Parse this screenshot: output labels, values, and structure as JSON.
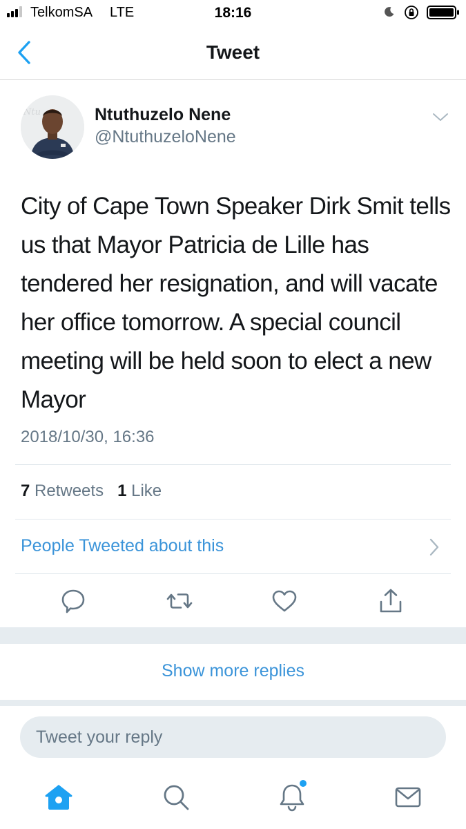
{
  "status_bar": {
    "carrier": "TelkomSA",
    "network": "LTE",
    "time": "18:16",
    "signal_bars_filled": 3,
    "signal_bars_total": 4
  },
  "nav": {
    "title": "Tweet",
    "back_icon": "chevron-left-icon"
  },
  "tweet": {
    "author_name": "Ntuthuzelo Nene",
    "author_handle": "@NtuthuzeloNene",
    "text": "City of Cape Town Speaker Dirk Smit tells us that Mayor Patricia de Lille has tendered her resignation, and will vacate her office tomorrow. A special council meeting will be held soon to elect a new Mayor",
    "timestamp": "2018/10/30, 16:36",
    "retweet_count": "7",
    "retweet_label": "Retweets",
    "like_count": "1",
    "like_label": "Like"
  },
  "people_tweeted": "People Tweeted about this",
  "actions": [
    "reply-icon",
    "retweet-icon",
    "like-icon",
    "share-icon"
  ],
  "show_more": "Show more replies",
  "reply": {
    "placeholder": "Tweet your reply"
  },
  "tab_bar": [
    "home-icon",
    "search-icon",
    "notifications-icon",
    "messages-icon"
  ],
  "colors": {
    "accent": "#1da1f2",
    "link": "#3b94d9",
    "secondary_text": "#657786",
    "divider": "#e1e8ed",
    "background_gray": "#e6ecf0"
  }
}
